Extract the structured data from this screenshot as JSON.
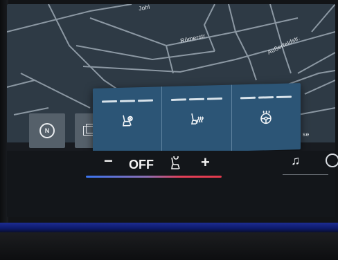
{
  "map": {
    "streets": [
      "Römerstr.",
      "Außerfeldstr.",
      "Johl",
      "se"
    ]
  },
  "buttons": {
    "nav": "N"
  },
  "climate_popup": {
    "items": [
      {
        "name": "seat-ventilation",
        "level": 0
      },
      {
        "name": "seat-heating",
        "level": 0
      },
      {
        "name": "steering-wheel-heating",
        "level": 0
      }
    ]
  },
  "climate_bar": {
    "minus": "−",
    "status": "OFF",
    "plus": "+"
  },
  "colors": {
    "popup": "#2c5576",
    "map": "#2e3a45",
    "temp_cold": "#3a74f0",
    "temp_hot": "#e23a4c"
  }
}
